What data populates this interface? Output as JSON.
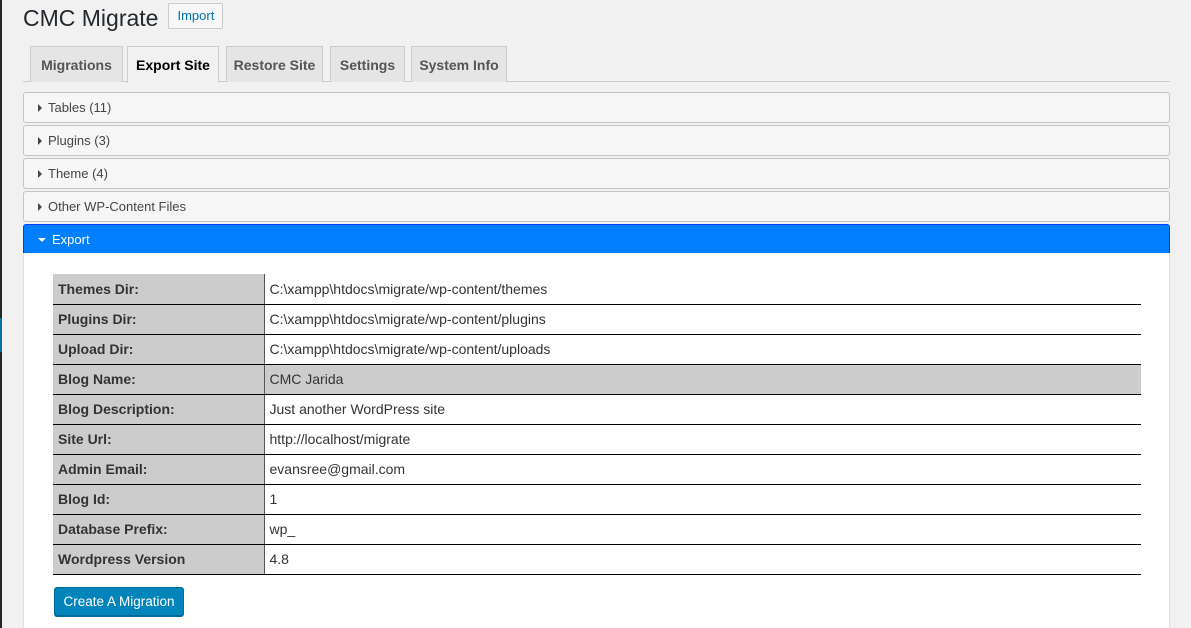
{
  "header": {
    "title": "CMC Migrate",
    "import_label": "Import"
  },
  "tabs": [
    {
      "label": "Migrations",
      "active": false
    },
    {
      "label": "Export Site",
      "active": true
    },
    {
      "label": "Restore Site",
      "active": false
    },
    {
      "label": "Settings",
      "active": false
    },
    {
      "label": "System Info",
      "active": false
    }
  ],
  "accordion": [
    {
      "label": "Tables (11)",
      "expanded": false
    },
    {
      "label": "Plugins (3)",
      "expanded": false
    },
    {
      "label": "Theme (4)",
      "expanded": false
    },
    {
      "label": "Other WP-Content Files",
      "expanded": false
    },
    {
      "label": "Export",
      "expanded": true
    }
  ],
  "export": {
    "rows": [
      {
        "key": "Themes Dir:",
        "value": "C:\\xampp\\htdocs\\migrate/wp-content/themes"
      },
      {
        "key": "Plugins Dir:",
        "value": "C:\\xampp\\htdocs\\migrate/wp-content/plugins"
      },
      {
        "key": "Upload Dir:",
        "value": "C:\\xampp\\htdocs\\migrate/wp-content/uploads"
      },
      {
        "key": "Blog Name:",
        "value": "CMC Jarida"
      },
      {
        "key": "Blog Description:",
        "value": "Just another WordPress site"
      },
      {
        "key": "Site Url:",
        "value": "http://localhost/migrate"
      },
      {
        "key": "Admin Email:",
        "value": "evansree@gmail.com"
      },
      {
        "key": "Blog Id:",
        "value": "1"
      },
      {
        "key": "Database Prefix:",
        "value": "wp_"
      },
      {
        "key": "Wordpress Version",
        "value": "4.8"
      }
    ],
    "button_label": "Create A Migration"
  },
  "colors": {
    "accent": "#007fff",
    "button": "#0085ba",
    "link": "#0073aa"
  }
}
